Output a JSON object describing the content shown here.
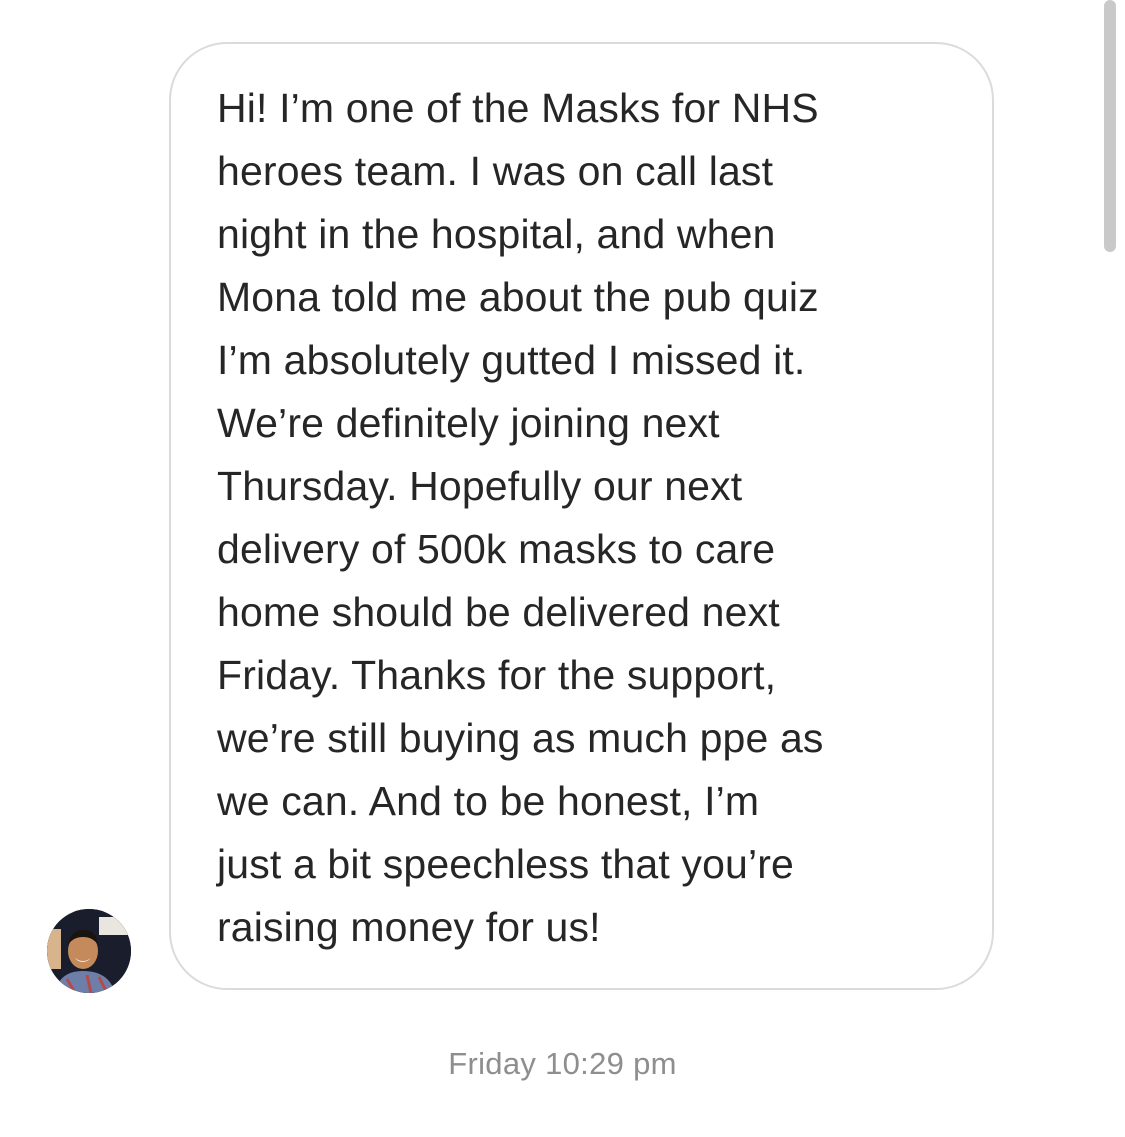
{
  "conversation": {
    "message": {
      "lines": [
        "Hi! I’m one of the Masks for NHS",
        "heroes team. I was on call last",
        "night in the hospital, and when",
        "Mona told me about the pub quiz",
        "I’m absolutely gutted I missed it.",
        "We’re definitely joining next",
        "Thursday. Hopefully our next",
        "delivery of 500k masks to care",
        "home should be delivered next",
        "Friday. Thanks for the support,",
        "we’re still buying as much ppe as",
        "we can. And to be honest, I’m",
        "just a bit speechless that you’re",
        "raising money for us!"
      ]
    },
    "sender_avatar_icon": "user-avatar-photo",
    "timestamp": "Friday 10:29 pm"
  }
}
